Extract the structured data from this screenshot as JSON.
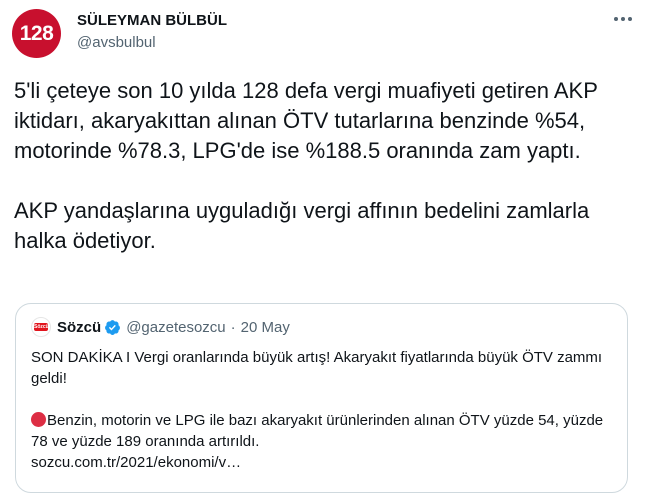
{
  "author": {
    "avatar_text": "128",
    "display_name": "SÜLEYMAN BÜLBÜL",
    "handle": "@avsbulbul"
  },
  "tweet": {
    "paragraphs": [
      "5'li çeteye son 10 yılda 128 defa vergi muafiyeti getiren AKP iktidarı, akaryakıttan alınan ÖTV tutarlarına benzinde %54, motorinde %78.3, LPG'de ise %188.5 oranında zam yaptı.",
      "AKP yandaşlarına uyguladığı vergi affının bedelini zamlarla halka ödetiyor."
    ]
  },
  "quoted_tweet": {
    "avatar_text": "Sözcü",
    "display_name": "Sözcü",
    "handle": "@gazetesozcu",
    "separator": "·",
    "date": "20 May",
    "line1": "SON DAKİKA I Vergi oranlarında büyük artış! Akaryakıt fiyatlarında büyük ÖTV zammı geldi!",
    "line2": "Benzin, motorin ve LPG ile bazı akaryakıt ürünlerinden alınan ÖTV yüzde 54, yüzde 78 ve yüzde 189 oranında artırıldı.",
    "link": "sozcu.com.tr/2021/ekonomi/v…"
  },
  "colors": {
    "avatar_bg": "#c8102e",
    "verified": "#1d9bf0",
    "secondary_text": "#536471",
    "border": "#cfd9de"
  }
}
